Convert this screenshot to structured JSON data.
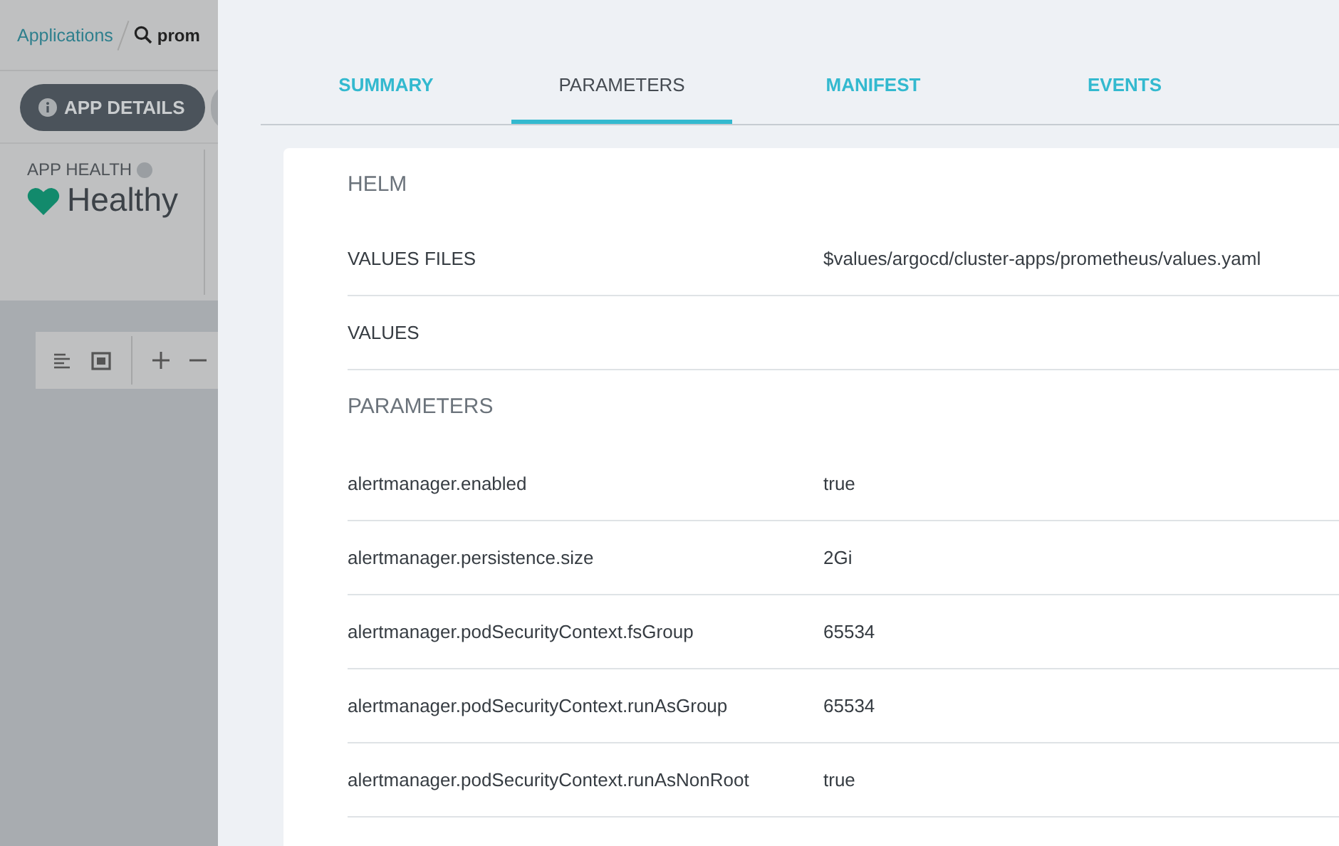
{
  "breadcrumb": {
    "link": "Applications",
    "search": "prom"
  },
  "app_details_button": {
    "label": "APP DETAILS"
  },
  "health": {
    "label": "APP HEALTH",
    "status": "Healthy"
  },
  "tabs": [
    {
      "label": "SUMMARY",
      "selected": false
    },
    {
      "label": "PARAMETERS",
      "selected": true
    },
    {
      "label": "MANIFEST",
      "selected": false
    },
    {
      "label": "EVENTS",
      "selected": false
    }
  ],
  "sections": [
    {
      "title": "HELM",
      "rows": [
        {
          "key": "VALUES FILES",
          "value": "$values/argocd/cluster-apps/prometheus/values.yaml"
        },
        {
          "key": "VALUES"
        }
      ]
    },
    {
      "title": "PARAMETERS",
      "rows": [
        {
          "key": "alertmanager.enabled",
          "value": "true"
        },
        {
          "key": "alertmanager.persistence.size",
          "value": "2Gi"
        },
        {
          "key": "alertmanager.podSecurityContext.fsGroup",
          "value": "65534"
        },
        {
          "key": "alertmanager.podSecurityContext.runAsGroup",
          "value": "65534"
        },
        {
          "key": "alertmanager.podSecurityContext.runAsNonRoot",
          "value": "true"
        }
      ]
    }
  ]
}
